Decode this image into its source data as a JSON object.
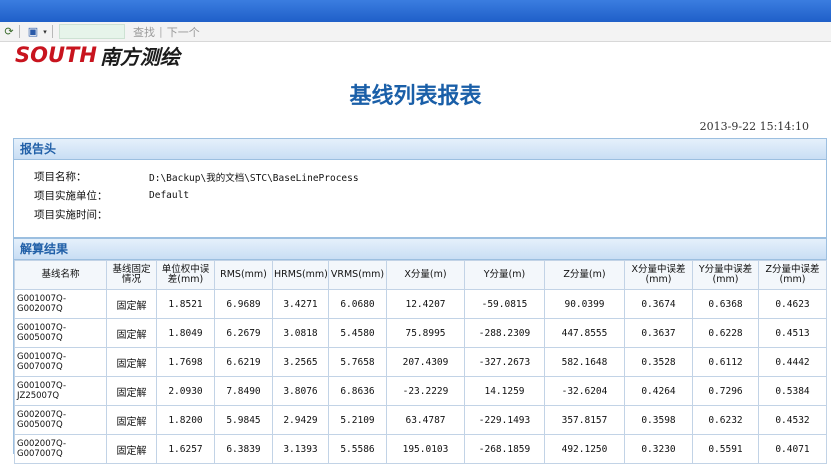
{
  "toolbar": {
    "find_label": "查找",
    "next_label": "下一个"
  },
  "logo": {
    "en": "SOUTH",
    "cn": "南方测绘",
    "brand_color": "#c8141e"
  },
  "report": {
    "title": "基线列表报表",
    "date": "2013-9-22 15:14:10"
  },
  "header_section": {
    "title": "报告头",
    "rows": [
      {
        "label": "项目名称：",
        "value": "D:\\Backup\\我的文档\\STC\\BaseLineProcess"
      },
      {
        "label": "项目实施单位：",
        "value": "Default"
      },
      {
        "label": "项目实施时间：",
        "value": ""
      }
    ]
  },
  "results_section": {
    "title": "解算结果",
    "columns": [
      "基线名称",
      "基线固定情况",
      "单位权中误差(mm)",
      "RMS(mm)",
      "HRMS(mm)",
      "VRMS(mm)",
      "X分量(m)",
      "Y分量(m)",
      "Z分量(m)",
      "X分量中误差(mm)",
      "Y分量中误差(mm)",
      "Z分量中误差(mm)"
    ],
    "rows": [
      [
        "G001007Q-G002007Q",
        "固定解",
        "1.8521",
        "6.9689",
        "3.4271",
        "6.0680",
        "12.4207",
        "-59.0815",
        "90.0399",
        "0.3674",
        "0.6368",
        "0.4623"
      ],
      [
        "G001007Q-G005007Q",
        "固定解",
        "1.8049",
        "6.2679",
        "3.0818",
        "5.4580",
        "75.8995",
        "-288.2309",
        "447.8555",
        "0.3637",
        "0.6228",
        "0.4513"
      ],
      [
        "G001007Q-G007007Q",
        "固定解",
        "1.7698",
        "6.6219",
        "3.2565",
        "5.7658",
        "207.4309",
        "-327.2673",
        "582.1648",
        "0.3528",
        "0.6112",
        "0.4442"
      ],
      [
        "G001007Q-JZ25007Q",
        "固定解",
        "2.0930",
        "7.8490",
        "3.8076",
        "6.8636",
        "-23.2229",
        "14.1259",
        "-32.6204",
        "0.4264",
        "0.7296",
        "0.5384"
      ],
      [
        "G002007Q-G005007Q",
        "固定解",
        "1.8200",
        "5.9845",
        "2.9429",
        "5.2109",
        "63.4787",
        "-229.1493",
        "357.8157",
        "0.3598",
        "0.6232",
        "0.4532"
      ],
      [
        "G002007Q-G007007Q",
        "固定解",
        "1.6257",
        "6.3839",
        "3.1393",
        "5.5586",
        "195.0103",
        "-268.1859",
        "492.1250",
        "0.3230",
        "0.5591",
        "0.4071"
      ]
    ]
  }
}
